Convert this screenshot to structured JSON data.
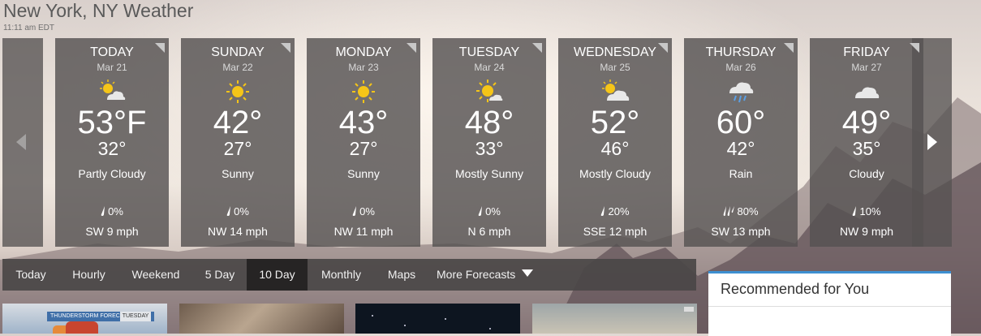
{
  "page": {
    "title": "New York, NY Weather",
    "updated_time": "11:11 am EDT"
  },
  "forecast": [
    {
      "day": "TODAY",
      "date": "Mar 21",
      "icon": "partly-cloudy-icon",
      "high": "53°F",
      "low": "32°",
      "condition": "Partly Cloudy",
      "precip": "0%",
      "precip_icon": "raindrop-icon",
      "wind": "SW 9 mph"
    },
    {
      "day": "SUNDAY",
      "date": "Mar 22",
      "icon": "sunny-icon",
      "high": "42°",
      "low": "27°",
      "condition": "Sunny",
      "precip": "0%",
      "precip_icon": "raindrop-icon",
      "wind": "NW 14 mph"
    },
    {
      "day": "MONDAY",
      "date": "Mar 23",
      "icon": "sunny-icon",
      "high": "43°",
      "low": "27°",
      "condition": "Sunny",
      "precip": "0%",
      "precip_icon": "raindrop-icon",
      "wind": "NW 11 mph"
    },
    {
      "day": "TUESDAY",
      "date": "Mar 24",
      "icon": "mostly-sunny-icon",
      "high": "48°",
      "low": "33°",
      "condition": "Mostly Sunny",
      "precip": "0%",
      "precip_icon": "raindrop-icon",
      "wind": "N 6 mph"
    },
    {
      "day": "WEDNESDAY",
      "date": "Mar 25",
      "icon": "mostly-cloudy-icon",
      "high": "52°",
      "low": "46°",
      "condition": "Mostly Cloudy",
      "precip": "20%",
      "precip_icon": "raindrop-icon",
      "wind": "SSE 12 mph"
    },
    {
      "day": "THURSDAY",
      "date": "Mar 26",
      "icon": "rain-icon",
      "high": "60°",
      "low": "42°",
      "condition": "Rain",
      "precip": "80%",
      "precip_icon": "rain-drops-icon",
      "wind": "SW 13 mph"
    },
    {
      "day": "FRIDAY",
      "date": "Mar 27",
      "icon": "cloudy-icon",
      "high": "49°",
      "low": "35°",
      "condition": "Cloudy",
      "precip": "10%",
      "precip_icon": "raindrop-icon",
      "wind": "NW 9 mph"
    }
  ],
  "nav": {
    "tabs": [
      {
        "label": "Today"
      },
      {
        "label": "Hourly"
      },
      {
        "label": "Weekend"
      },
      {
        "label": "5 Day"
      },
      {
        "label": "10 Day",
        "active": true
      },
      {
        "label": "Monthly"
      },
      {
        "label": "Maps"
      },
      {
        "label": "More Forecasts",
        "has_dropdown": true
      }
    ]
  },
  "recommended": {
    "title": "Recommended for You"
  },
  "thumbnails": [
    {
      "label": "THUNDERSTORM FORECAST",
      "day": "TUESDAY"
    },
    {},
    {},
    {}
  ],
  "colors": {
    "card_bg": "#565252",
    "nav_bg": "#4a4646",
    "nav_active": "#262424",
    "sun": "#f5c518",
    "accent_blue": "#3d8fd1"
  }
}
